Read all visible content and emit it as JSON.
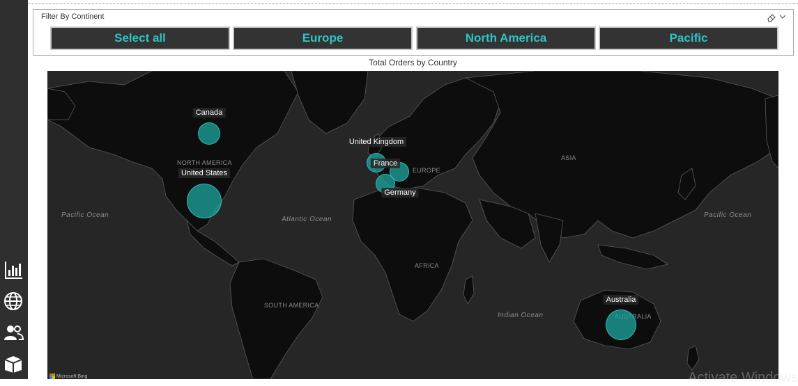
{
  "sidebar": {
    "items": [
      {
        "icon": "bar-chart-icon"
      },
      {
        "icon": "globe-icon"
      },
      {
        "icon": "users-icon"
      },
      {
        "icon": "box-icon"
      }
    ]
  },
  "slicer": {
    "title": "Filter By Continent",
    "options": [
      "Select all",
      "Europe",
      "North America",
      "Pacific"
    ]
  },
  "map": {
    "title": "Total Orders by Country",
    "points": [
      {
        "country": "Canada",
        "label": "Canada"
      },
      {
        "country": "United States",
        "label": "United States"
      },
      {
        "country": "United Kingdom",
        "label": "United Kingdom"
      },
      {
        "country": "France",
        "label": "France"
      },
      {
        "country": "Germany",
        "label": "Germany"
      },
      {
        "country": "Australia",
        "label": "Australia"
      }
    ],
    "regions": {
      "north_america": "NORTH AMERICA",
      "south_america": "SOUTH AMERICA",
      "europe": "EUROPE",
      "asia": "ASIA",
      "africa": "AFRICA",
      "australia": "AUSTRALIA"
    },
    "oceans": {
      "pacific_west": "Pacific Ocean",
      "pacific_east": "Pacific Ocean",
      "atlantic": "Atlantic Ocean",
      "indian": "Indian Ocean"
    },
    "attribution": "Microsoft Bing",
    "watermark": "Activate Windows"
  },
  "colors": {
    "accent": "#2ec4c4",
    "bubble": "#1ea5a0",
    "map_bg": "#262626",
    "land": "#0d0d0d",
    "border": "#5a5a5a"
  }
}
